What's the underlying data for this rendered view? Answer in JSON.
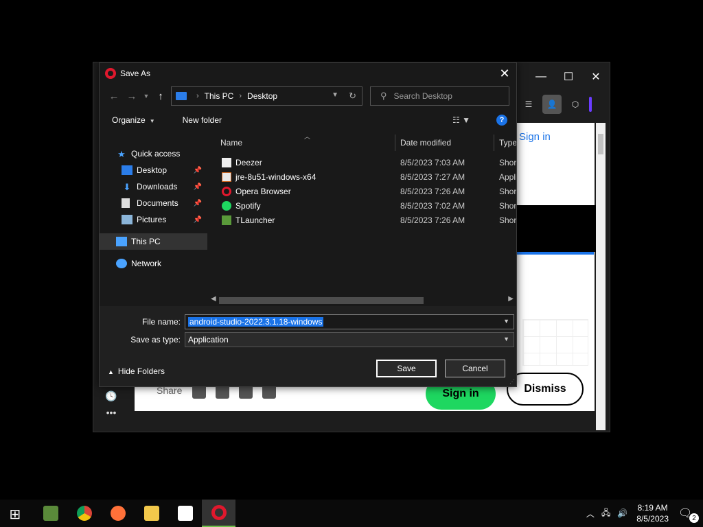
{
  "browser": {
    "top_signin": "Sign in",
    "share_label": "Share",
    "signin_button": "Sign in",
    "dismiss_button": "Dismiss"
  },
  "dialog": {
    "title": "Save As",
    "close_glyph": "✕",
    "address": {
      "crumbs": [
        "This PC",
        "Desktop"
      ]
    },
    "search_placeholder": "Search Desktop",
    "commands": {
      "organize": "Organize",
      "new_folder": "New folder"
    },
    "nav_pane": [
      {
        "label": "Quick access",
        "icon": "star-icon"
      },
      {
        "label": "Desktop",
        "icon": "desktop-icon",
        "pinned": true
      },
      {
        "label": "Downloads",
        "icon": "download-icon",
        "pinned": true
      },
      {
        "label": "Documents",
        "icon": "documents-icon",
        "pinned": true
      },
      {
        "label": "Pictures",
        "icon": "pictures-icon",
        "pinned": true
      },
      {
        "label": "This PC",
        "icon": "computer-icon",
        "selected": true
      },
      {
        "label": "Network",
        "icon": "network-icon"
      }
    ],
    "columns": [
      "Name",
      "Date modified",
      "Type"
    ],
    "files": [
      {
        "name": "Deezer",
        "date": "8/5/2023 7:03 AM",
        "type": "Short",
        "icon": "deezer-icon"
      },
      {
        "name": "jre-8u51-windows-x64",
        "date": "8/5/2023 7:27 AM",
        "type": "Appli",
        "icon": "jre-installer-icon"
      },
      {
        "name": "Opera Browser",
        "date": "8/5/2023 7:26 AM",
        "type": "Short",
        "icon": "opera-icon"
      },
      {
        "name": "Spotify",
        "date": "8/5/2023 7:02 AM",
        "type": "Short",
        "icon": "spotify-icon"
      },
      {
        "name": "TLauncher",
        "date": "8/5/2023 7:26 AM",
        "type": "Short",
        "icon": "tlauncher-icon"
      }
    ],
    "file_name_label": "File name:",
    "file_name_value": "android-studio-2022.3.1.18-windows",
    "save_type_label": "Save as type:",
    "save_type_value": "Application",
    "hide_folders": "Hide Folders",
    "save_button": "Save",
    "cancel_button": "Cancel"
  },
  "taskbar": {
    "apps": [
      "start-icon",
      "minecraft-icon",
      "chrome-icon",
      "firefox-icon",
      "file-explorer-icon",
      "store-icon",
      "opera-icon"
    ],
    "active_app": "opera-icon",
    "time": "8:19 AM",
    "date": "8/5/2023",
    "notification_count": "2"
  }
}
